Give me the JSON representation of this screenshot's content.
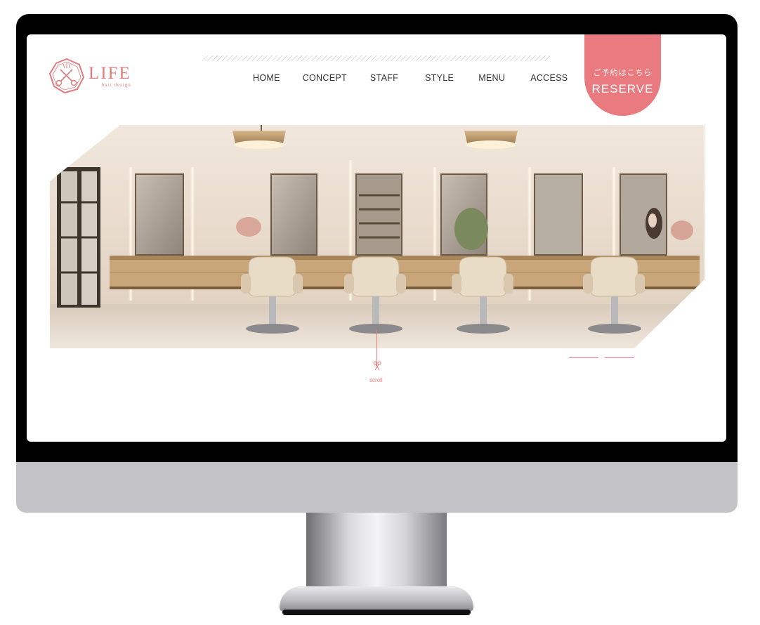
{
  "logo": {
    "title": "LIFE",
    "subtitle": "hair design",
    "icon": "scissors-logo-icon"
  },
  "nav": {
    "items": [
      "HOME",
      "CONCEPT",
      "STAFF",
      "STYLE",
      "MENU",
      "ACCESS"
    ]
  },
  "reserve": {
    "jp": "ご予約はこちら",
    "en": "RESERVE"
  },
  "scroll": {
    "label": "scroll",
    "icon": "scissors-icon"
  },
  "colors": {
    "accent": "#e97a7f",
    "frame": "#000000",
    "chin": "#c3c2c7"
  },
  "hero": {
    "description_icon": "salon-interior-image"
  }
}
